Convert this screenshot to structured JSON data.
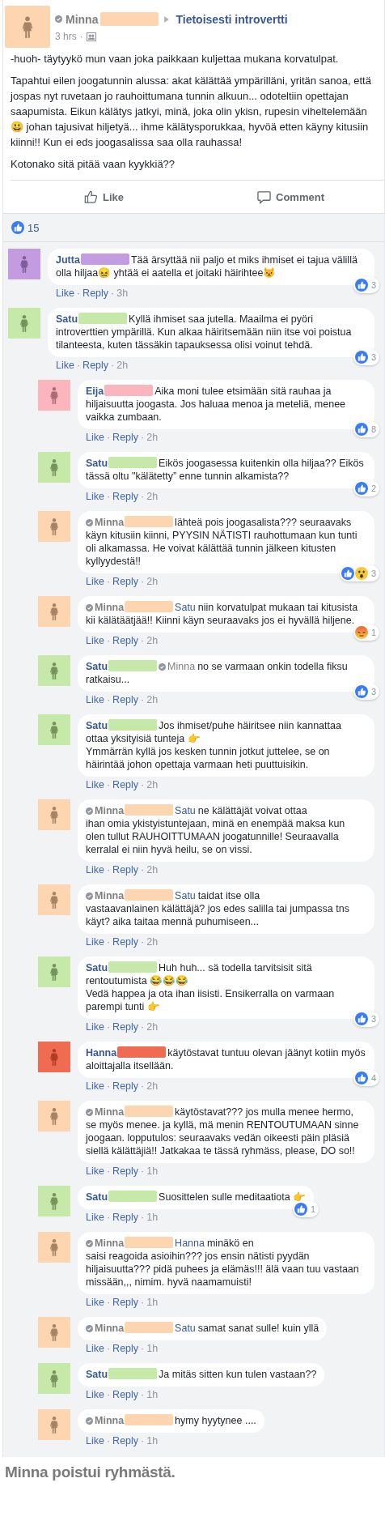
{
  "post": {
    "author": {
      "name": "Minna",
      "verified": true,
      "color": "#fdd5b1"
    },
    "group": "Tietoisesti introvertti",
    "time": "3 hrs",
    "separator": "·",
    "paragraphs": [
      "-huoh- täytyykö mun vaan joka paikkaan kuljettaa mukana korvatulpat.",
      "Tapahtui eilen joogatunnin alussa: akat kälättää ympärilläni, yritän sanoa, että jospas nyt ruvetaan jo rauhoittumana tunnin alkuun... odoteltiin opettajan saapumista. Eikun kälätys jatkyi, minä, joka olin ykisn, rupesin viheltelemään 😃 johan tajusivat hiljetyä... ihme kälätysporukkaa, hyvöä etten käyny kitusiin kiinni!! Kun ei eds joogasalissa saa olla rauhassa!",
      "Kotonako sitä pitää vaan kyykkiä??"
    ],
    "actions": [
      "Like",
      "Comment"
    ],
    "reaction_count": "15"
  },
  "comments": [
    {
      "author": "Jutta",
      "verified": false,
      "color": "#c39be0",
      "text": "Tää ärsyttää nii paljo et miks ihmiset ei tajua välillä olla hiljaa😖 yhtää ei aatella et joitaki häirihtee😾",
      "reactions": [
        {
          "kind": "like"
        }
      ],
      "reaction_count": "3",
      "meta": [
        "Like",
        "·",
        "Reply",
        "·",
        "3h"
      ]
    },
    {
      "author": "Satu",
      "verified": false,
      "color": "#c6e8a8",
      "text": "Kyllä ihmiset saa jutella. Maailma ei pyöri introverttien ympärillä. Kun alkaa häiritsemään niin itse voi poistua tilanteesta, kuten tässäkin tapauksessa olisi voinut tehdä.",
      "reactions": [
        {
          "kind": "like"
        }
      ],
      "reaction_count": "3",
      "meta": [
        "Like",
        "·",
        "Reply",
        "·",
        "2h"
      ],
      "children": [
        {
          "author": "Eija",
          "verified": false,
          "color": "#fbb5bd",
          "text": "Aika moni tulee etsimään sitä rauhaa ja hiljaisuutta joogasta. Jos haluaa menoa ja meteliä, menee vaikka zumbaan.",
          "reactions": [
            {
              "kind": "like"
            }
          ],
          "reaction_count": "8",
          "meta": [
            "Like",
            "·",
            "Reply",
            "·",
            "2h"
          ]
        },
        {
          "author": "Satu",
          "verified": false,
          "color": "#c6e8a8",
          "text": "Eikös joogasessa kuitenkin olla hiljaa?? Eikös tässä oltu \"kälätetty” enne tunnin alkamista??",
          "reactions": [
            {
              "kind": "like"
            }
          ],
          "reaction_count": "2",
          "meta": [
            "Like",
            "·",
            "Reply",
            "·",
            "2h"
          ]
        },
        {
          "author": "Minna",
          "verified": true,
          "color": "#fdd5b1",
          "text": "lähteä pois joogasalista??? seuraavaks käyn kitusiin kiinni, PYYSIN NÄTISTI rauhottumaan kun tunti oli alkamassa. He voivat kälättää tunnin jälkeen kitusten kyllyydestä!!",
          "reactions": [
            {
              "kind": "like"
            },
            {
              "kind": "wow"
            }
          ],
          "reaction_count": "3",
          "meta": [
            "Like",
            "·",
            "Reply",
            "·",
            "2h"
          ]
        },
        {
          "author": "Minna",
          "verified": true,
          "color": "#fdd5b1",
          "mention": {
            "name": "Satu",
            "verified": false
          },
          "text": "niin korvatulpat mukaan tai kitusista kii kälätäätjää!! Kiinni käyn seuraavaks jos ei hyvällä hiljene.",
          "reactions": [
            {
              "kind": "angry"
            }
          ],
          "reaction_count": "1",
          "meta": [
            "Like",
            "·",
            "Reply",
            "·",
            "2h"
          ]
        },
        {
          "author": "Satu",
          "verified": false,
          "color": "#c6e8a8",
          "mention": {
            "name": "Minna",
            "verified": true
          },
          "text": "no se varmaan onkin todella fiksu ratkaisu...",
          "reactions": [
            {
              "kind": "like"
            }
          ],
          "reaction_count": "3",
          "meta": [
            "Like",
            "·",
            "Reply",
            "·",
            "2h"
          ]
        },
        {
          "author": "Satu",
          "verified": false,
          "color": "#c6e8a8",
          "text": "Jos ihmiset/puhe häiritsee niin kannattaa ottaa yksityisiä tunteja 👉\nYmmärrän kyllä jos kesken tunnin jotkut juttelee, se on häirintää johon opettaja varmaan heti puuttuisikin.",
          "meta": [
            "Like",
            "·",
            "Reply",
            "·",
            "2h"
          ]
        },
        {
          "author": "Minna",
          "verified": true,
          "color": "#fdd5b1",
          "mention": {
            "name": "Satu",
            "verified": false
          },
          "text": "ne kälättäjät voivat ottaa\nihan omia ykistyistuntejaan, minä en enempää maksa kun olen tullut RAUHOITTUMAAN joogatunnille! Seuraavalla kerralal ei niin hyvä heilu, se on vissi.",
          "meta": [
            "Like",
            "·",
            "Reply",
            "·",
            "2h"
          ]
        },
        {
          "author": "Minna",
          "verified": true,
          "color": "#fdd5b1",
          "mention": {
            "name": "Satu",
            "verified": false
          },
          "text": "taidat itse olla\nvastaavanlainen kälättäjä? jos edes salilla tai jumpassa tns käyt? aika taitaa mennä puhumiseen...",
          "meta": [
            "Like",
            "·",
            "Reply",
            "·",
            "2h"
          ]
        },
        {
          "author": "Satu",
          "verified": false,
          "color": "#c6e8a8",
          "text": "Huh huh... sä todella tarvitsisit sitä\nrentoutumista 😂😂😂\nVedä happea ja ota ihan iisisti. Ensikerralla on varmaan parempi tunti 👉",
          "reactions": [
            {
              "kind": "like"
            }
          ],
          "reaction_count": "3",
          "meta": [
            "Like",
            "·",
            "Reply",
            "·",
            "2h"
          ]
        },
        {
          "author": "Hanna",
          "verified": false,
          "color": "#ef6c52",
          "text": "käytöstavat tuntuu olevan jäänyt kotiin myös aloittajalla itsellään.",
          "reactions": [
            {
              "kind": "like"
            }
          ],
          "reaction_count": "4",
          "meta": [
            "Like",
            "·",
            "Reply",
            "·",
            "2h"
          ]
        },
        {
          "author": "Minna",
          "verified": true,
          "color": "#fdd5b1",
          "text": "käytöstavat??? jos mulla menee hermo, se myös menee. ja kyllä, mä menin RENTOUTUMAAN sinne joogaan. lopputulos: seuraavaks vedän oikeesti päin pläsiä siellä kälättäjiä!! Jatkakaa te tässä ryhmäss, please, DO so!!",
          "meta": [
            "Like",
            "·",
            "Reply",
            "·",
            "1h"
          ]
        },
        {
          "author": "Satu",
          "verified": false,
          "color": "#c6e8a8",
          "text": "Suosittelen sulle meditaatiota 👉",
          "reactions": [
            {
              "kind": "like"
            }
          ],
          "reaction_count": "1",
          "meta": [
            "Like",
            "·",
            "Reply",
            "·",
            "1h"
          ]
        },
        {
          "author": "Minna",
          "verified": true,
          "color": "#fdd5b1",
          "mention": {
            "name": "Hanna",
            "verified": false
          },
          "text": "minäkö en\nsaisi reagoida asioihin??? jos ensin nätisti pyydän hiljaisuutta??? pidä puhees ja elämäs!!! älä vaan tuu vastaan missään,,, nimim. hyvä naamamuisti!",
          "meta": [
            "Like",
            "·",
            "Reply",
            "·",
            "1h"
          ]
        },
        {
          "author": "Minna",
          "verified": true,
          "color": "#fdd5b1",
          "mention": {
            "name": "Satu",
            "verified": false
          },
          "text": "samat sanat sulle! kuin yllä",
          "meta": [
            "Like",
            "·",
            "Reply",
            "·",
            "1h"
          ]
        },
        {
          "author": "Satu",
          "verified": false,
          "color": "#c6e8a8",
          "text": "Ja mitäs sitten kun tulen vastaan??",
          "meta": [
            "Like",
            "·",
            "Reply",
            "·",
            "1h"
          ]
        },
        {
          "author": "Minna",
          "verified": true,
          "color": "#fdd5b1",
          "text": "hymy hyytynee ....",
          "meta": [
            "Like",
            "·",
            "Reply",
            "·",
            "1h"
          ]
        }
      ]
    }
  ],
  "caption": "Minna poistui ryhmästä."
}
